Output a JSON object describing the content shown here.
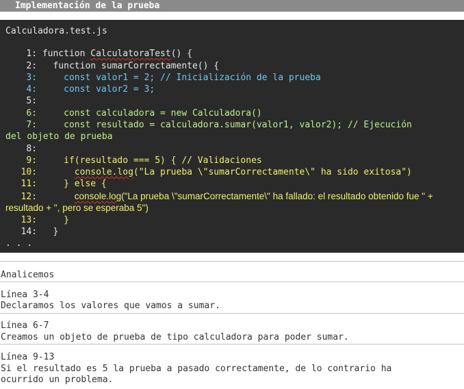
{
  "title": "Implementación de la prueba",
  "code": {
    "filename": "Calculadora.test.js",
    "lines": [
      {
        "num": "1:",
        "pre": "function ",
        "fn": "CalculatoraTest",
        "post": "() {"
      },
      {
        "num": "2:",
        "text": "  function sumarCorrectamente() {"
      },
      {
        "num": "3:",
        "text": "    const valor1 = 2; // Inicialización de la prueba"
      },
      {
        "num": "4:",
        "text": "    const valor2 = 3;"
      },
      {
        "num": "5:",
        "text": ""
      },
      {
        "num": "6:",
        "text": "    const calculadora = new Calculadora()"
      },
      {
        "num": "7:",
        "text": "    const resultado = calculadora.sumar(valor1, valor2); // Ejecución",
        "cont": "del objeto de prueba"
      },
      {
        "num": "8:",
        "text": ""
      },
      {
        "num": "9:",
        "text": "    if(resultado === 5) { // Validaciones"
      },
      {
        "num": "10:",
        "pre": "      ",
        "call": "console.log",
        "post": "(\"La prueba \\\"sumarCorrectamente\\\" ha sido exitosa\")"
      },
      {
        "num": "11:",
        "text": "    } else {"
      },
      {
        "num": "12:",
        "pre": "      ",
        "call": "console.log",
        "post": "(\"La prueba \\\"sumarCorrectamente\\\" ha fallado: el resultado obtenido fue \" +",
        "cont": "resultado + \", pero se esperaba 5\")"
      },
      {
        "num": "13:",
        "text": "    }"
      },
      {
        "num": "14:",
        "text": "  }"
      }
    ],
    "ellipsis": ". . ."
  },
  "analysis": {
    "heading": "Analicemos",
    "items": [
      {
        "label": "Línea 3-4",
        "text": "Declaramos los valores que vamos a sumar."
      },
      {
        "label": "Línea 6-7",
        "text": "Creamos un objeto de prueba de tipo calculadora para poder sumar."
      },
      {
        "label": "Línea 9-13",
        "text": "Si el resultado es 5 la prueba a pasado correctamente, de lo contrario ha",
        "text2": "ocurrido un problema."
      }
    ]
  }
}
